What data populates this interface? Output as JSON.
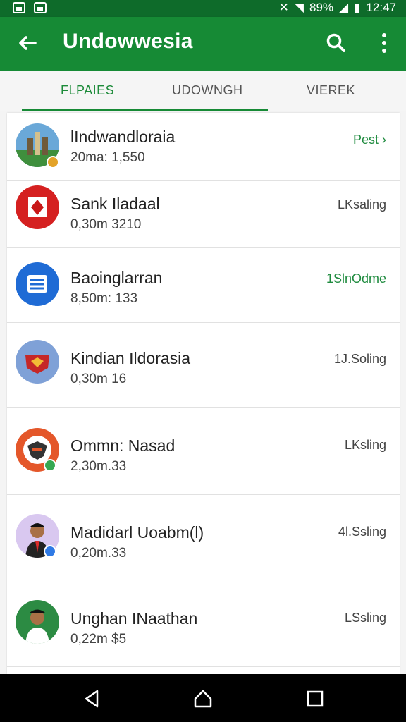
{
  "status": {
    "battery_percent": "89%",
    "time": "12:47"
  },
  "app": {
    "title": "Undowwesia"
  },
  "tabs": [
    {
      "label": "FLPAIES",
      "active": true
    },
    {
      "label": "UDOWNGH",
      "active": false
    },
    {
      "label": "VIEREK",
      "active": false
    }
  ],
  "list": [
    {
      "name": "lIndwandloraia",
      "meta": "20ma: 1,550",
      "action": "Pest",
      "action_color": "#1f8b3f"
    },
    {
      "name": "Sank Iladaal",
      "meta": "0,30m 3210",
      "action": "LKsaling",
      "action_color": "#444444"
    },
    {
      "name": "Baoinglarran",
      "meta": "8,50m: 133",
      "action": "1SlnOdme",
      "action_color": "#1f8b3f"
    },
    {
      "name": "Kindian Ildorasia",
      "meta": "0,30m 16",
      "action": "1J.Soling",
      "action_color": "#444444"
    },
    {
      "name": "Ommn: Nasad",
      "meta": "2,30m.33",
      "action": "LKsling",
      "action_color": "#444444"
    },
    {
      "name": "Madidarl Uoabm(l)",
      "meta": "0,20m.33",
      "action": "4l.Ssling",
      "action_color": "#444444"
    },
    {
      "name": "Unghan INaathan",
      "meta": "0,22m $5",
      "action": "LSsling",
      "action_color": "#444444"
    }
  ],
  "colors": {
    "appbar": "#168a35",
    "status": "#0e6b2a",
    "accent": "#178a36"
  }
}
